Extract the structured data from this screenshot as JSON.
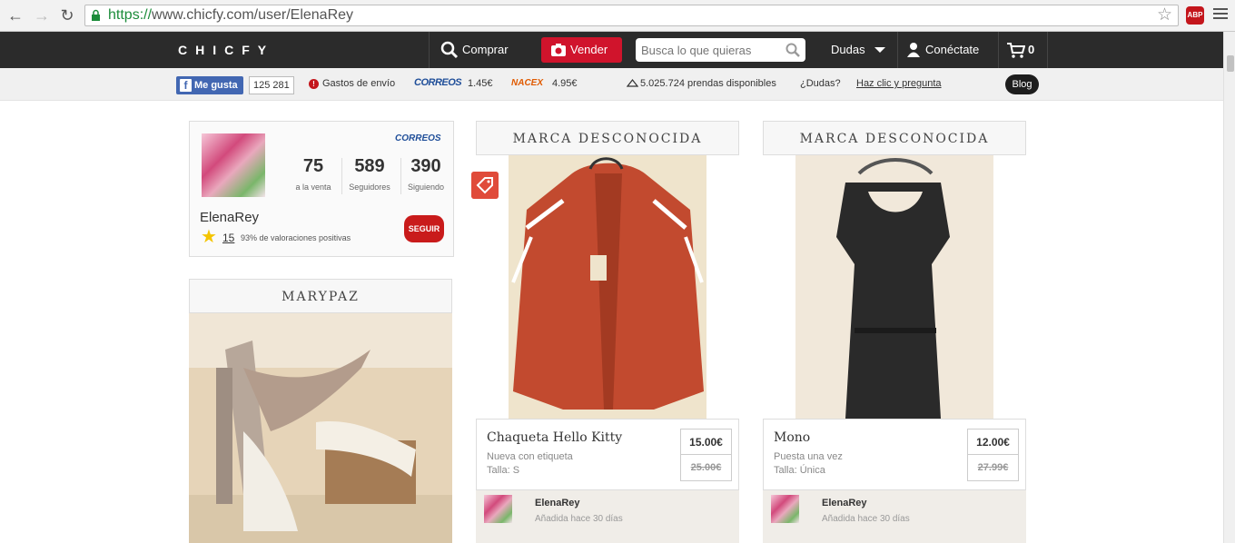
{
  "browser": {
    "url_scheme": "https://",
    "url_rest": "www.chicfy.com/user/ElenaRey",
    "abp_label": "ABP"
  },
  "header": {
    "logo": "CHICFY",
    "comprar": "Comprar",
    "vender": "Vender",
    "search_placeholder": "Busca lo que quieras",
    "dudas": "Dudas",
    "conectate": "Conéctate",
    "cart_count": "0"
  },
  "infobar": {
    "fb_like": "Me gusta",
    "fb_count": "125 281",
    "shipping_label": "Gastos de envío",
    "correos_logo": "CORREOS",
    "correos_price": "1.45€",
    "nacex_logo": "NACEX",
    "nacex_price": "4.95€",
    "items_available": "5.025.724 prendas disponibles",
    "dudas_q": "¿Dudas?",
    "help_link": "Haz clic y pregunta",
    "blog": "Blog"
  },
  "profile": {
    "correos_logo": "CORREOS",
    "stats": [
      {
        "value": "75",
        "label": "a la venta"
      },
      {
        "value": "589",
        "label": "Seguidores"
      },
      {
        "value": "390",
        "label": "Siguiendo"
      }
    ],
    "username": "ElenaRey",
    "rating_count": "15",
    "positive": "93% de valoraciones positivas",
    "follow": "SEGUIR"
  },
  "cards": [
    {
      "brand": "MARYPAZ"
    },
    {
      "brand": "MARCA DESCONOCIDA",
      "title": "Chaqueta Hello Kitty",
      "condition": "Nueva con etiqueta",
      "size": "Talla: S",
      "price": "15.00€",
      "old_price": "25.00€",
      "seller": "ElenaRey",
      "added": "Añadida hace 30 días"
    },
    {
      "brand": "MARCA DESCONOCIDA",
      "title": "Mono",
      "condition": "Puesta una vez",
      "size": "Talla: Única",
      "price": "12.00€",
      "old_price": "27.99€",
      "seller": "ElenaRey",
      "added": "Añadida hace 30 días"
    }
  ]
}
